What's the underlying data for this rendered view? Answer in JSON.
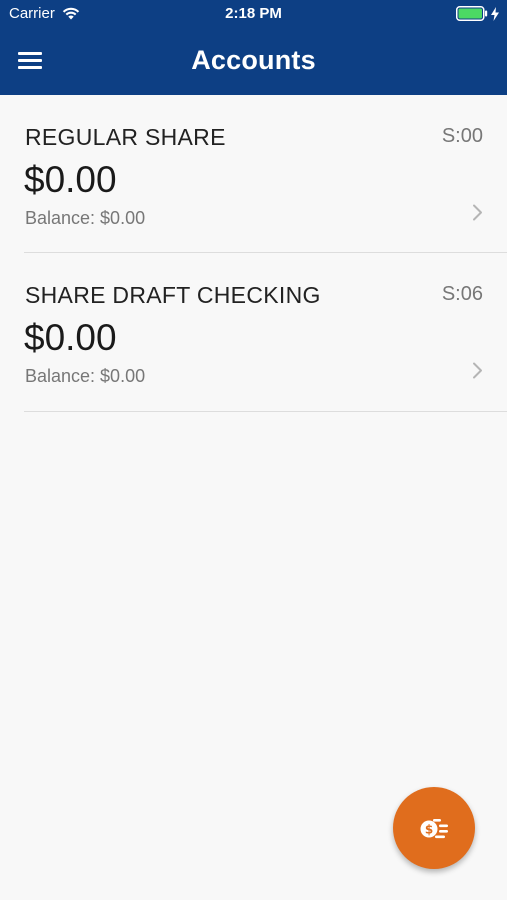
{
  "status_bar": {
    "carrier": "Carrier",
    "time": "2:18 PM",
    "battery_color": "#4cd964"
  },
  "header": {
    "title": "Accounts",
    "background_color": "#0d3f84",
    "menu_icon": "hamburger-menu-icon"
  },
  "accounts": [
    {
      "name": "REGULAR SHARE",
      "id": "S:00",
      "amount": "$0.00",
      "balance": "Balance: $0.00"
    },
    {
      "name": "SHARE DRAFT CHECKING",
      "id": "S:06",
      "amount": "$0.00",
      "balance": "Balance: $0.00"
    }
  ],
  "fab": {
    "icon": "money-transfer-icon",
    "color": "#e06d1d"
  }
}
